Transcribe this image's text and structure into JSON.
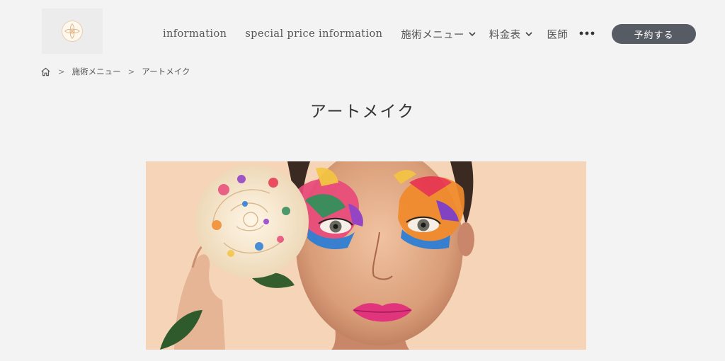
{
  "nav": {
    "items": [
      {
        "label": "information",
        "dropdown": false
      },
      {
        "label": "special price information",
        "dropdown": false
      },
      {
        "label": "施術メニュー",
        "dropdown": true
      },
      {
        "label": "料金表",
        "dropdown": true
      },
      {
        "label": "医師",
        "dropdown": false
      }
    ],
    "more_icon": "more-horizontal-icon",
    "reserve_label": "予約する"
  },
  "breadcrumb": {
    "home_icon": "home-icon",
    "separator": ">",
    "items": [
      "施術メニュー",
      "アートメイク"
    ]
  },
  "main": {
    "title": "アートメイク"
  },
  "colors": {
    "background": "#f3f3f3",
    "button": "#565b64",
    "button_text": "#ffffff",
    "hero_background": "#f5d3b5"
  }
}
